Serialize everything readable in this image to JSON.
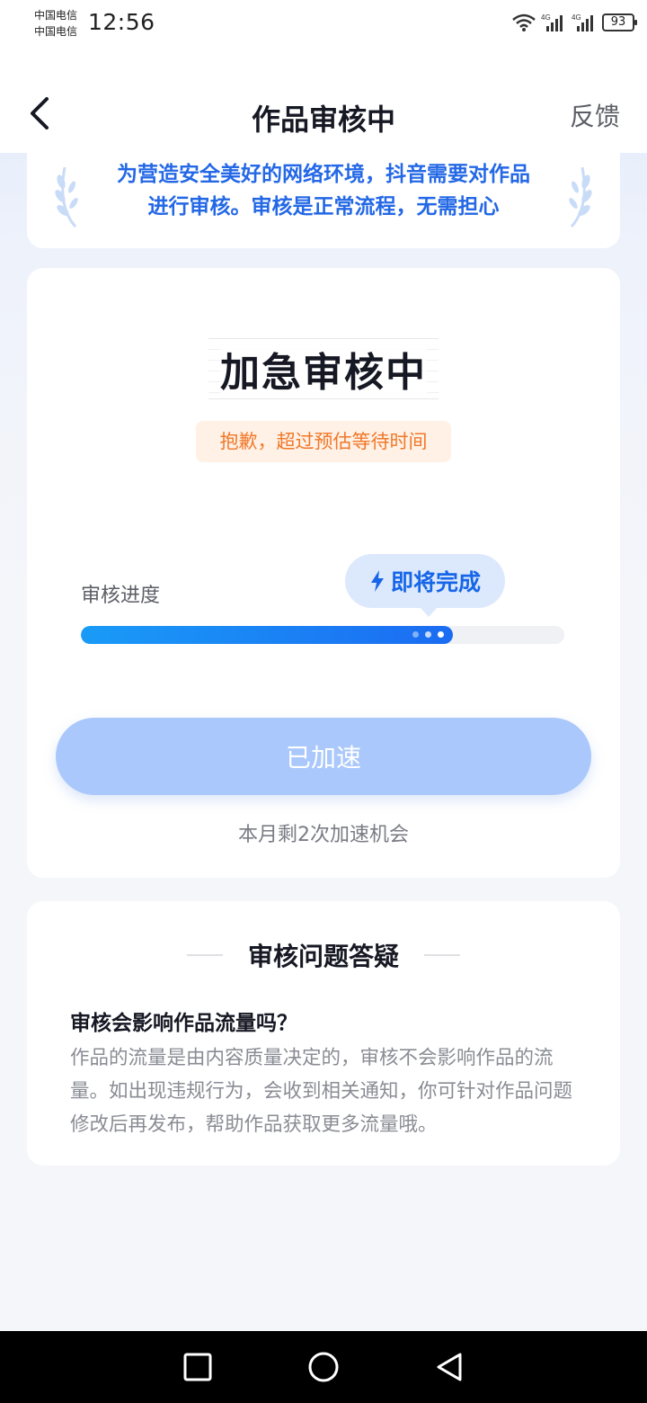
{
  "status_bar": {
    "carrier_1": "中国电信",
    "carrier_2": "中国电信",
    "time": "12:56",
    "network_1": "4G",
    "network_2": "4G",
    "battery": "93"
  },
  "header": {
    "title": "作品审核中",
    "feedback_label": "反馈"
  },
  "notice": {
    "line_1": "为营造安全美好的网络环境，抖音需要对作品",
    "line_2": "进行审核。审核是正常流程，无需担心"
  },
  "status_card": {
    "title": "加急审核中",
    "apology": "抱歉，超过预估等待时间",
    "progress_label": "审核进度",
    "progress_bubble": "即将完成",
    "progress_fraction": 0.77,
    "accel_button_label": "已加速",
    "remaining_text": "本月剩2次加速机会"
  },
  "faq": {
    "heading": "审核问题答疑",
    "question": "审核会影响作品流量吗？",
    "answer": "作品的流量是由内容质量决定的，审核不会影响作品的流量。如出现违规行为，会收到相关通知，你可针对作品问题修改后再发布，帮助作品获取更多流量哦。"
  },
  "colors": {
    "accent": "#1b6cf2",
    "notice_text": "#2468e6",
    "apology_text": "#f0782a",
    "apology_bg": "#fff1e5",
    "button_disabled": "#aac8fb"
  },
  "icons": {
    "back": "chevron-left-icon",
    "lightning": "lightning-icon",
    "laurel": "laurel-icon",
    "wifi": "wifi-icon",
    "signal": "signal-icon",
    "nav_recent": "square-icon",
    "nav_home": "circle-icon",
    "nav_back": "triangle-back-icon"
  }
}
